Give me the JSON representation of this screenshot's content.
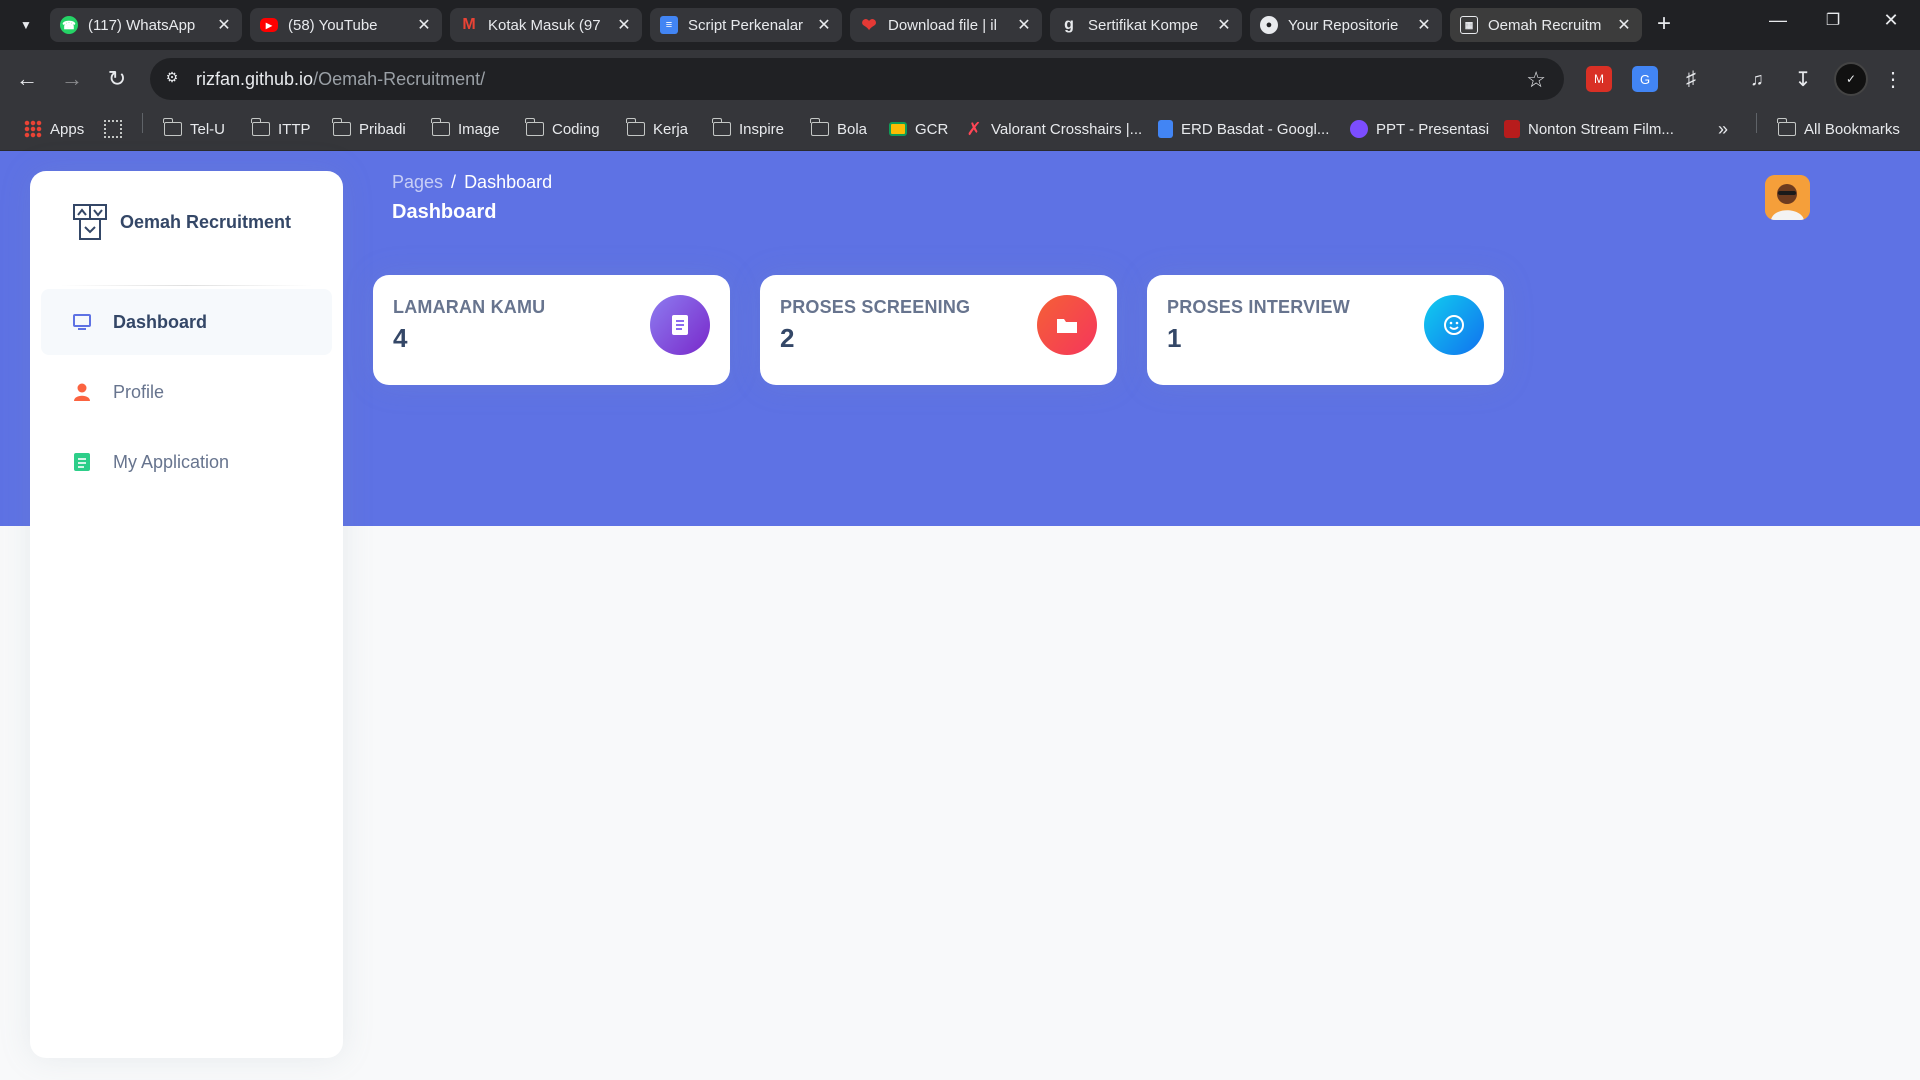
{
  "browser": {
    "tabs": [
      {
        "title": "(117) WhatsApp",
        "icon": "whatsapp-icon",
        "color": "#25d366"
      },
      {
        "title": "(58) YouTube",
        "icon": "youtube-icon",
        "color": "#ff0000"
      },
      {
        "title": "Kotak Masuk (97",
        "icon": "gmail-icon",
        "color": "#ea4335"
      },
      {
        "title": "Script Perkenalar",
        "icon": "google-docs-icon",
        "color": "#4285f4"
      },
      {
        "title": "Download file | il",
        "icon": "heart-icon",
        "color": "#e53935"
      },
      {
        "title": "Sertifikat Kompe",
        "icon": "g-icon",
        "color": "#5f6368"
      },
      {
        "title": "Your Repositorie",
        "icon": "github-icon",
        "color": "#e8eaed"
      },
      {
        "title": "Oemah Recruitm",
        "icon": "site-icon",
        "color": "#e8eaed",
        "active": true
      }
    ],
    "url_host": "rizfan.github.io",
    "url_path": "/Oemah-Recruitment/",
    "bookmarks": [
      {
        "label": "Apps",
        "type": "apps"
      },
      {
        "label": "Tel-U",
        "type": "folder"
      },
      {
        "label": "ITTP",
        "type": "folder"
      },
      {
        "label": "Pribadi",
        "type": "folder"
      },
      {
        "label": "Image",
        "type": "folder"
      },
      {
        "label": "Coding",
        "type": "folder"
      },
      {
        "label": "Kerja",
        "type": "folder"
      },
      {
        "label": "Inspire",
        "type": "folder"
      },
      {
        "label": "Bola",
        "type": "folder"
      },
      {
        "label": "GCR",
        "type": "site"
      },
      {
        "label": "Valorant Crosshairs |...",
        "type": "site"
      },
      {
        "label": "ERD Basdat - Googl...",
        "type": "site"
      },
      {
        "label": "PPT - Presentasi",
        "type": "site"
      },
      {
        "label": "Nonton Stream Film...",
        "type": "site"
      }
    ],
    "all_bookmarks": "All Bookmarks"
  },
  "app": {
    "brand": "Oemah Recruitment",
    "nav": [
      {
        "label": "Dashboard",
        "active": true
      },
      {
        "label": "Profile",
        "active": false
      },
      {
        "label": "My Application",
        "active": false
      }
    ],
    "breadcrumb": {
      "root": "Pages",
      "separator": "/",
      "current": "Dashboard"
    },
    "page_title": "Dashboard",
    "cards": [
      {
        "label": "LAMARAN KAMU",
        "value": "4",
        "icon": "document-icon",
        "color": "#7e5bef"
      },
      {
        "label": "PROSES SCREENING",
        "value": "2",
        "icon": "folder-icon",
        "color": "#f5365c"
      },
      {
        "label": "PROSES INTERVIEW",
        "value": "1",
        "icon": "smile-icon",
        "color": "#11cdef"
      }
    ]
  },
  "colors": {
    "primary": "#5e72e4",
    "text": "#344767",
    "muted": "#67748e"
  }
}
